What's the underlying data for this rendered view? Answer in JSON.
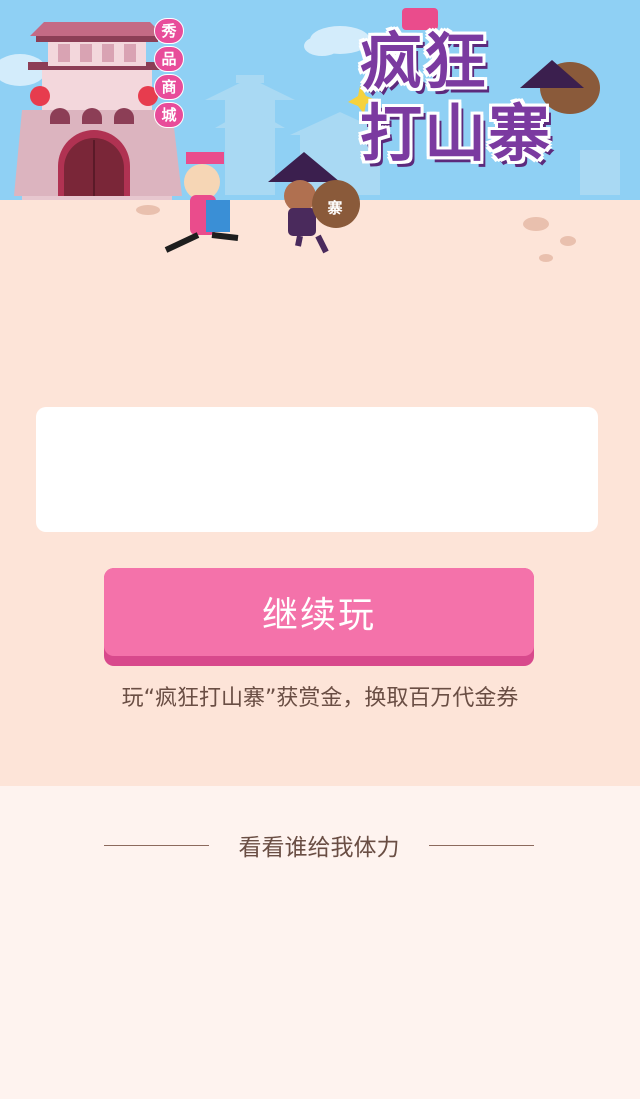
{
  "banner": {
    "mall_tag": [
      "秀",
      "品",
      "商",
      "城"
    ],
    "game_title_line1": "疯狂",
    "game_title_line2": "打山寨",
    "bag_label": "寨"
  },
  "actions": {
    "continue_label": "继续玩",
    "reward_text": "玩“疯狂打山寨”获赏金，换取百万代金券"
  },
  "friends_section": {
    "title": "看看谁给我体力"
  },
  "colors": {
    "sky": "#8fd0f4",
    "sand": "#fde4d8",
    "lower_background": "#fef3ef",
    "button": "#f472aa",
    "button_shadow": "#d8498c",
    "title_purple": "#7b3aa0",
    "text_brown": "#6a4e44"
  }
}
